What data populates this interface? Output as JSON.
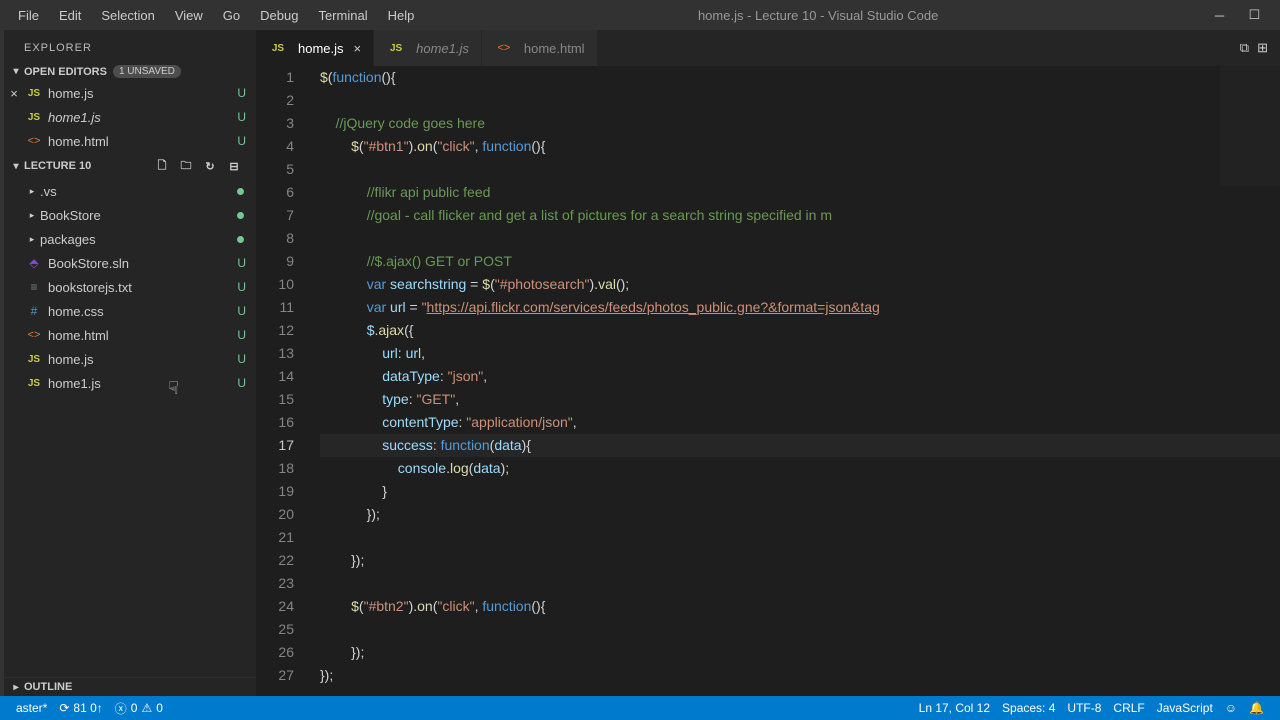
{
  "menubar": {
    "items": [
      "File",
      "Edit",
      "Selection",
      "View",
      "Go",
      "Debug",
      "Terminal",
      "Help"
    ],
    "title": "home.js - Lecture 10 - Visual Studio Code"
  },
  "sidebar": {
    "title": "EXPLORER",
    "openEditors": {
      "label": "OPEN EDITORS",
      "unsaved": "1 UNSAVED",
      "items": [
        {
          "name": "home.js",
          "icon": "JS",
          "status": "U",
          "close": true
        },
        {
          "name": "home1.js",
          "icon": "JS",
          "status": "U",
          "italic": true
        },
        {
          "name": "home.html",
          "icon": "<>",
          "status": "U"
        }
      ]
    },
    "project": {
      "label": "LECTURE 10",
      "folders": [
        {
          "name": ".vs",
          "dot": true
        },
        {
          "name": "BookStore",
          "dot": true
        },
        {
          "name": "packages",
          "dot": true
        }
      ],
      "files": [
        {
          "name": "BookStore.sln",
          "icon": "⬘",
          "iconClass": "sln-icon",
          "status": "U"
        },
        {
          "name": "bookstorejs.txt",
          "icon": "≡",
          "iconClass": "txt-icon",
          "status": "U"
        },
        {
          "name": "home.css",
          "icon": "#",
          "iconClass": "css-icon",
          "status": "U"
        },
        {
          "name": "home.html",
          "icon": "<>",
          "iconClass": "html-icon",
          "status": "U"
        },
        {
          "name": "home.js",
          "icon": "JS",
          "iconClass": "js-icon",
          "status": "U"
        },
        {
          "name": "home1.js",
          "icon": "JS",
          "iconClass": "js-icon",
          "status": "U"
        }
      ]
    },
    "outline": "OUTLINE"
  },
  "tabs": [
    {
      "label": "home.js",
      "icon": "JS",
      "active": true,
      "close": true
    },
    {
      "label": "home1.js",
      "icon": "JS",
      "active": false,
      "italic": true
    },
    {
      "label": "home.html",
      "icon": "<>",
      "active": false
    }
  ],
  "code": {
    "lines": 27,
    "currentLine": 17
  },
  "statusbar": {
    "branch": "aster*",
    "sync": "81 0↑",
    "errors": "0",
    "warnings": "0",
    "line": "Ln 17, Col 12",
    "spaces": "Spaces: 4",
    "encoding": "UTF-8",
    "eol": "CRLF",
    "lang": "JavaScript"
  }
}
